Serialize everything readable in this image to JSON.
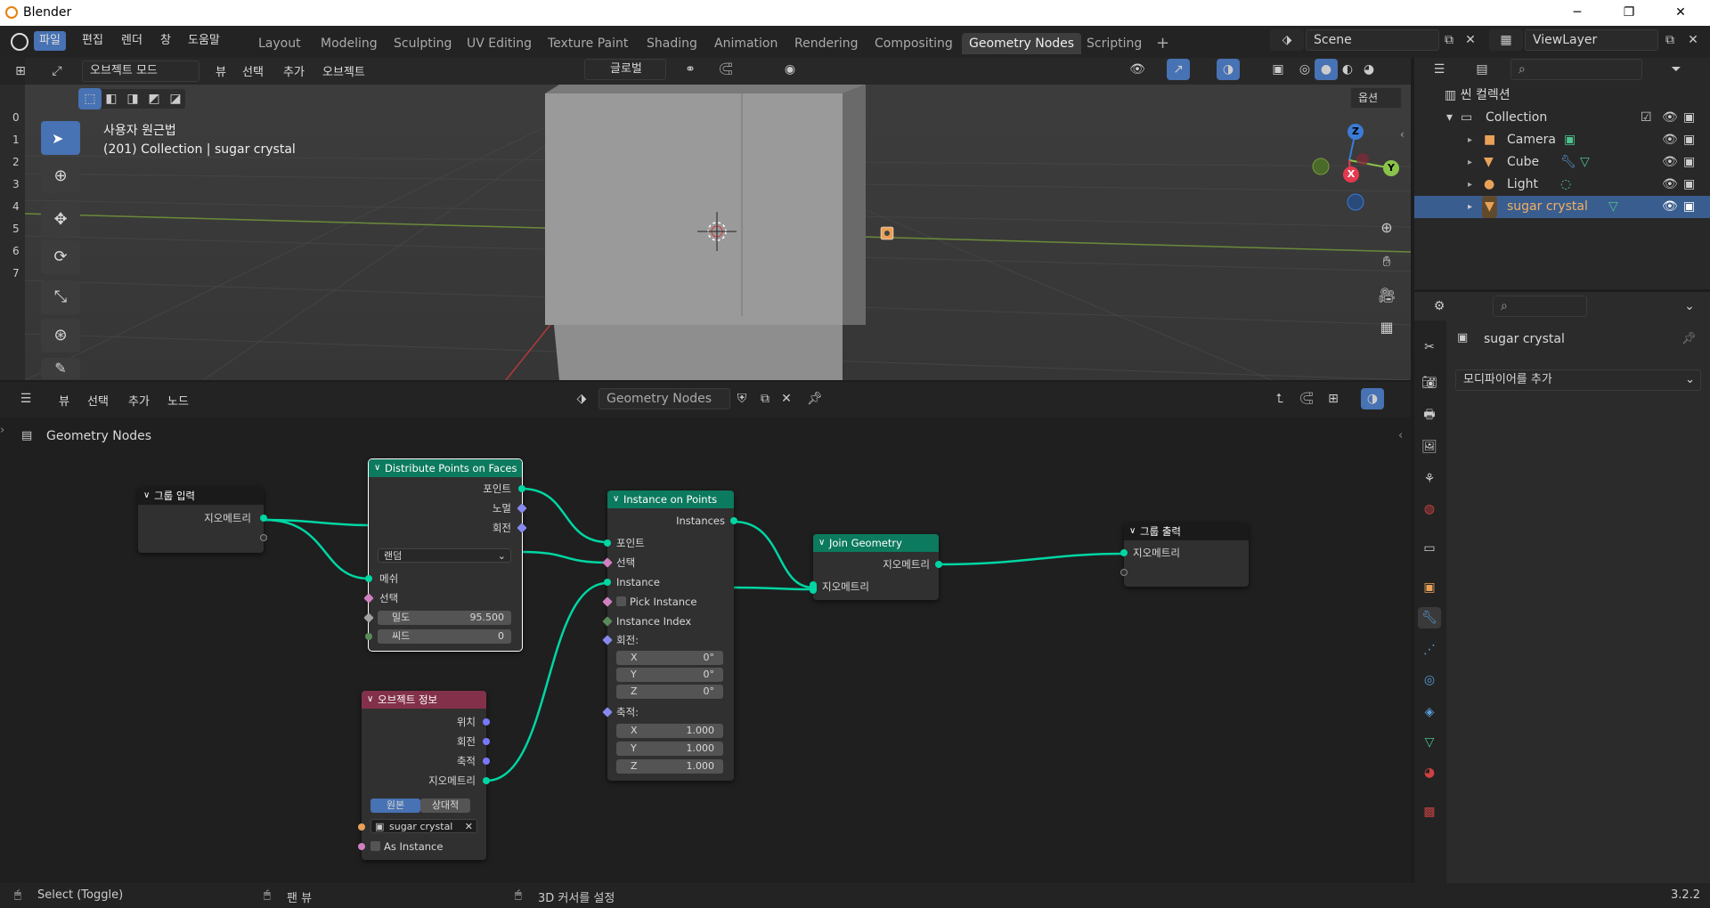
{
  "window": {
    "title": "Blender",
    "minimize": "─",
    "maximize": "❐",
    "close": "✕"
  },
  "menu": {
    "file": "파일",
    "edit": "편집",
    "render": "렌더",
    "window": "창",
    "help": "도움말"
  },
  "workspaces": [
    "Layout",
    "Modeling",
    "Sculpting",
    "UV Editing",
    "Texture Paint",
    "Shading",
    "Animation",
    "Rendering",
    "Compositing",
    "Geometry Nodes",
    "Scripting"
  ],
  "active_workspace": "Geometry Nodes",
  "add_workspace": "+",
  "scene": {
    "label": "Scene",
    "view_layer": "ViewLayer"
  },
  "viewport": {
    "mode": "오브젝트 모드",
    "menus": [
      "뷰",
      "선택",
      "추가",
      "오브젝트"
    ],
    "orientation": "글로벌",
    "options": "옵션",
    "overlay_title": "사용자 원근법",
    "overlay_subtitle": "(201) Collection | sugar crystal",
    "ruler": [
      "0",
      "1",
      "2",
      "3",
      "4",
      "5",
      "6",
      "7"
    ],
    "gizmo": {
      "z": "Z",
      "y": "Y",
      "x": "X"
    }
  },
  "outliner": {
    "root": "씬 컬렉션",
    "collection": "Collection",
    "items": [
      {
        "label": "Camera",
        "color": "#e8a258"
      },
      {
        "label": "Cube",
        "color": "#e8a258"
      },
      {
        "label": "Light",
        "color": "#e8a258"
      },
      {
        "label": "sugar crystal",
        "color": "#e8a258"
      }
    ]
  },
  "properties": {
    "object_name": "sugar crystal",
    "add_modifier": "모디파이어를 추가"
  },
  "node_editor": {
    "menus": [
      "뷰",
      "선택",
      "추가",
      "노드"
    ],
    "tree_name": "Geometry Nodes",
    "breadcrumb": "Geometry Nodes"
  },
  "nodes": {
    "group_input": {
      "title": "그룹 입력",
      "out_geometry": "지오메트리"
    },
    "distribute": {
      "title": "Distribute Points on Faces",
      "out_points": "포인트",
      "out_normal": "노멀",
      "out_rotation": "회전",
      "mode": "랜덤",
      "in_mesh": "메쉬",
      "in_selection": "선택",
      "density_label": "밀도",
      "density_value": "95.500",
      "seed_label": "씨드",
      "seed_value": "0"
    },
    "instance_on_points": {
      "title": "Instance on Points",
      "out_instances": "Instances",
      "in_points": "포인트",
      "in_selection": "선택",
      "in_instance": "Instance",
      "pick_instance": "Pick Instance",
      "instance_index": "Instance Index",
      "rotation": "회전:",
      "rot_x": "0°",
      "rot_y": "0°",
      "rot_z": "0°",
      "scale": "축적:",
      "scale_x": "1.000",
      "scale_y": "1.000",
      "scale_z": "1.000",
      "x": "X",
      "y": "Y",
      "z": "Z"
    },
    "join_geometry": {
      "title": "Join Geometry",
      "out_geometry": "지오메트리",
      "in_geometry": "지오메트리"
    },
    "group_output": {
      "title": "그룹 출력",
      "in_geometry": "지오메트리"
    },
    "object_info": {
      "title": "오브젝트 정보",
      "out_location": "위치",
      "out_rotation": "회전",
      "out_scale": "축적",
      "out_geometry": "지오메트리",
      "original": "원본",
      "relative": "상대적",
      "object": "sugar crystal",
      "as_instance": "As Instance"
    }
  },
  "status": {
    "select": "Select (Toggle)",
    "pan": "팬 뷰",
    "cursor": "3D 커서를 설정",
    "version": "3.2.2"
  },
  "colors": {
    "geo_socket": "#00d6a3",
    "selection": "#4772b3",
    "accent": "#e8a258",
    "input_header": "#1a1a1a",
    "geo_header": "#0c7a5e",
    "object_info_header": "#83314a"
  }
}
